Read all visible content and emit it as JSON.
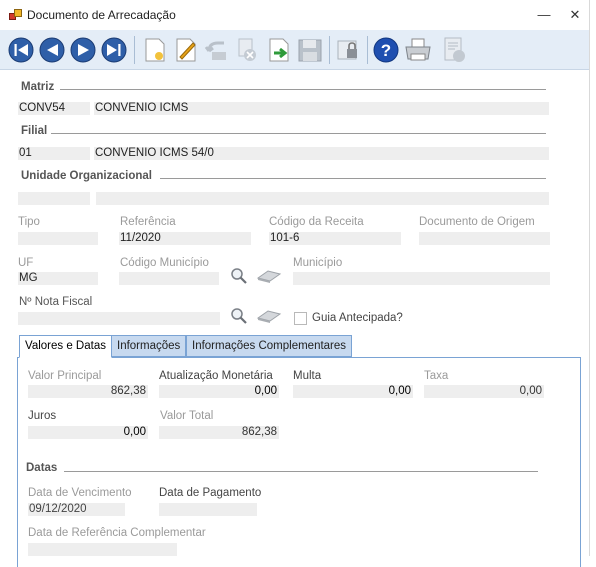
{
  "window": {
    "title": "Documento de Arrecadação",
    "minimize": "—",
    "close": "✕"
  },
  "toolbar": {
    "buttons": [
      "first-record",
      "previous-record",
      "next-record",
      "last-record",
      "new",
      "edit",
      "undo",
      "delete",
      "confirm",
      "save",
      "lock",
      "help",
      "print",
      "report"
    ]
  },
  "matriz": {
    "section": "Matriz",
    "code": "CONV54",
    "name": "CONVÊNIO ICMS"
  },
  "filial": {
    "section": "Filial",
    "code": "01",
    "name": "CONVÊNIO ICMS 54/0"
  },
  "unidade": {
    "section": "Unidade Organizacional",
    "code": "",
    "name": ""
  },
  "fields": {
    "tipo_label": "Tipo",
    "tipo_value": "",
    "referencia_label": "Referência",
    "referencia_value": "11/2020",
    "codigo_receita_label": "Código da Receita",
    "codigo_receita_value": "101-6",
    "documento_origem_label": "Documento de Origem",
    "documento_origem_value": "",
    "uf_label": "UF",
    "uf_value": "MG",
    "codigo_municipio_label": "Código Município",
    "codigo_municipio_value": "",
    "municipio_label": "Município",
    "municipio_value": "",
    "nota_fiscal_label": "Nº Nota Fiscal",
    "nota_fiscal_value": "",
    "guia_antecipada_label": "Guia Antecipada?",
    "guia_antecipada_checked": false
  },
  "tabs": [
    {
      "label": "Valores e Datas",
      "active": true
    },
    {
      "label": "Informações",
      "active": false
    },
    {
      "label": "Informações Complementares",
      "active": false
    }
  ],
  "valores": {
    "valor_principal_label": "Valor Principal",
    "valor_principal": "862,38",
    "atualizacao_label": "Atualização Monetária",
    "atualizacao": "0,00",
    "multa_label": "Multa",
    "multa": "0,00",
    "taxa_label": "Taxa",
    "taxa": "0,00",
    "juros_label": "Juros",
    "juros": "0,00",
    "valor_total_label": "Valor Total",
    "valor_total": "862,38"
  },
  "datas": {
    "section": "Datas",
    "vencimento_label": "Data de Vencimento",
    "vencimento": "09/12/2020",
    "pagamento_label": "Data de Pagamento",
    "pagamento": "",
    "referencia_compl_label": "Data de Referência Complementar",
    "referencia_compl": ""
  }
}
